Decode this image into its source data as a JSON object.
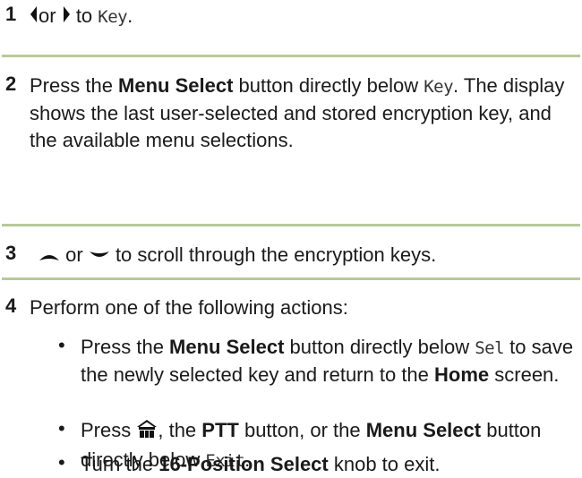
{
  "steps": [
    {
      "number": "1",
      "or": "or",
      "to": "to",
      "display": "Key",
      "end": ".",
      "icons": [
        "left-arrow-icon",
        "right-arrow-icon"
      ]
    },
    {
      "number": "2",
      "t1": "Press the ",
      "button": "Menu Select",
      "t2": " button directly below ",
      "display": "Key",
      "t3": ".",
      "rest": "The display shows the last user-selected and stored encryption key, and the available menu selections."
    },
    {
      "number": "3",
      "or": "or",
      "rest": "to scroll through the encryption keys.",
      "icons": [
        "up-arrow-icon",
        "down-arrow-icon"
      ]
    },
    {
      "number": "4",
      "intro": "Perform one of the following actions:",
      "bullets": [
        {
          "t1": "Press the ",
          "b1": "Menu Select",
          "t2": " button directly below ",
          "m1": "Sel",
          "t3": " to save the newly selected key and return to the ",
          "b2": "Home",
          "t4": " screen."
        },
        {
          "t1": "Press ",
          "icon": "home-icon",
          "t2": ", the ",
          "b1": "PTT",
          "t3": " button, or the ",
          "b2": "Menu Select",
          "t4": " button directly below ",
          "m1": "Exit",
          "t5": "."
        },
        {
          "t1": "Turn the ",
          "b1": "16-Position Select",
          "t2": " knob to exit."
        }
      ]
    }
  ],
  "bullet_char": "•",
  "colors": {
    "divider": "#b7c99a",
    "text": "#1a1a1a"
  }
}
